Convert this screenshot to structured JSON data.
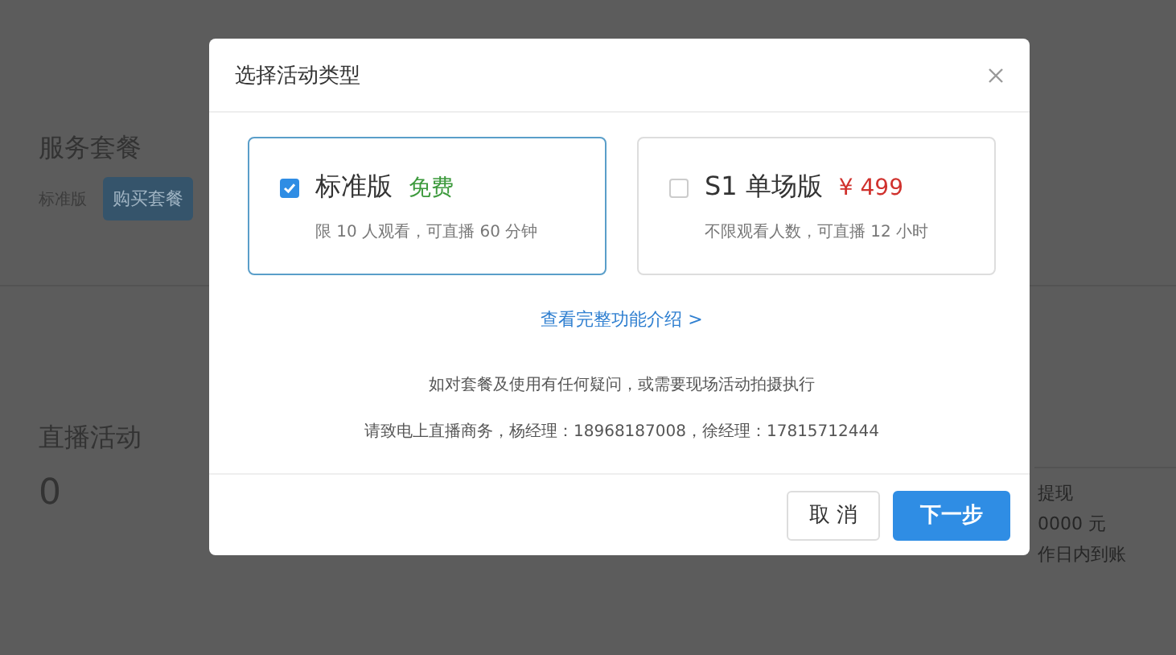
{
  "background": {
    "service": {
      "title": "服务套餐",
      "plan": "标准版",
      "button": "购买套餐"
    },
    "live": {
      "title": "直播活动",
      "count": "0"
    },
    "notes": [
      "提现",
      "0000 元",
      "作日内到账"
    ]
  },
  "dialog": {
    "title": "选择活动类型",
    "plans": [
      {
        "name": "标准版",
        "price": "免费",
        "color": "#3d9a3d",
        "description": "限 10 人观看，可直播 60 分钟",
        "selected": true
      },
      {
        "name": "S1 单场版",
        "price": "¥ 499",
        "color": "#d0312d",
        "description": "不限观看人数，可直播 12 小时",
        "selected": false
      }
    ],
    "link": "查看完整功能介绍 >",
    "info": [
      "如对套餐及使用有任何疑问，或需要现场活动拍摄执行",
      "请致电上直播商务，杨经理：18968187008，徐经理：17815712444"
    ],
    "buttons": [
      {
        "label": "取 消",
        "kind": "secondary"
      },
      {
        "label": "下一步",
        "kind": "primary"
      }
    ]
  }
}
